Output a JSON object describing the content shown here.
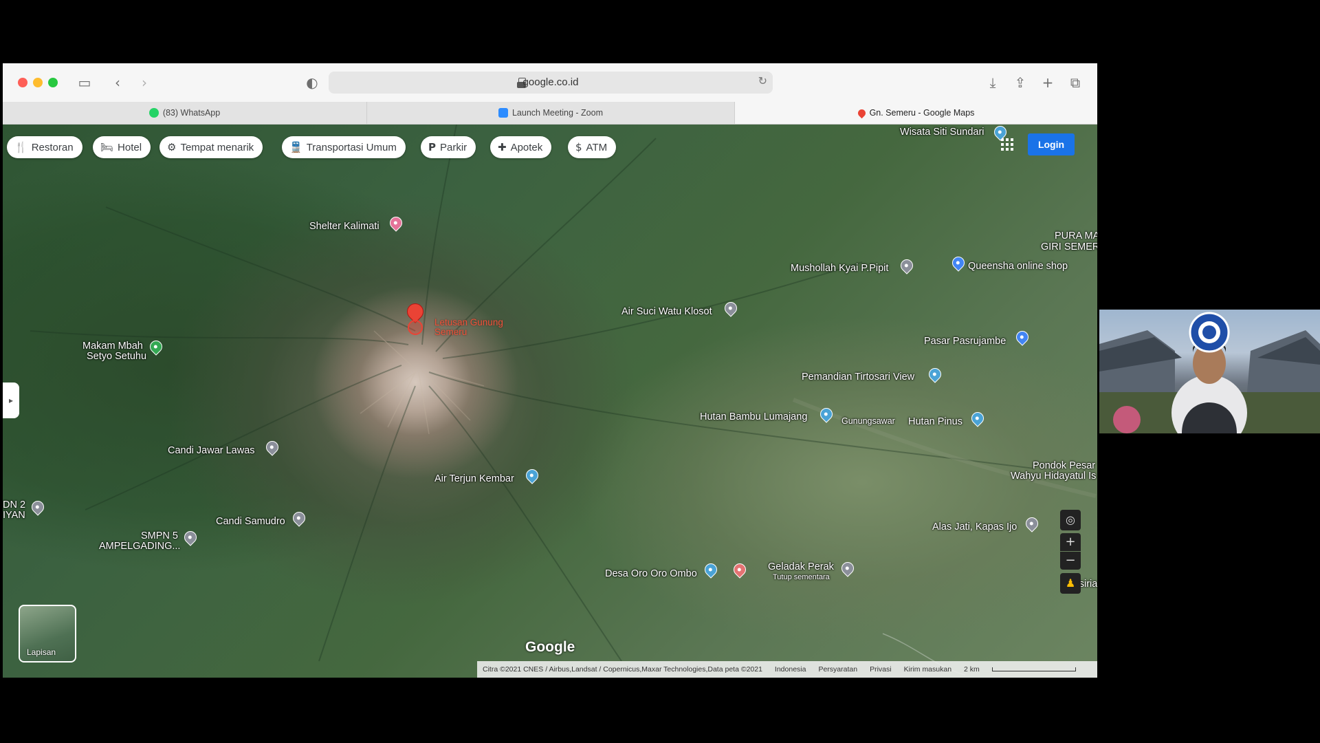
{
  "browser": {
    "url": "google.co.id",
    "tabs": [
      {
        "label": "(83) WhatsApp",
        "icon": "whatsapp-icon",
        "color": "#25d366"
      },
      {
        "label": "Launch Meeting - Zoom",
        "icon": "zoom-icon",
        "color": "#2d8cff"
      },
      {
        "label": "Gn. Semeru - Google Maps",
        "icon": "google-maps-icon",
        "color": "#ea4335"
      }
    ]
  },
  "chips": [
    {
      "label": "Restoran",
      "icon": "restaurant-icon",
      "glyph": "🍴"
    },
    {
      "label": "Hotel",
      "icon": "hotel-icon",
      "glyph": "🛏"
    },
    {
      "label": "Tempat menarik",
      "icon": "attraction-icon",
      "glyph": "⚙"
    },
    {
      "label": "Transportasi Umum",
      "icon": "transit-icon",
      "glyph": "🚆"
    },
    {
      "label": "Parkir",
      "icon": "parking-icon",
      "glyph": "P"
    },
    {
      "label": "Apotek",
      "icon": "pharmacy-icon",
      "glyph": "✚"
    },
    {
      "label": "ATM",
      "icon": "atm-icon",
      "glyph": "$"
    }
  ],
  "header": {
    "login_label": "Login"
  },
  "places": {
    "wisata": "Wisata Siti Sundari",
    "shelter": "Shelter Kalimati",
    "pura1": "PURA MA",
    "pura2": "GIRI SEMERU",
    "mushollah": "Mushollah Kyai P.Pipit",
    "queensha": "Queensha online shop",
    "letusan1": "Letusan Gunung",
    "letusan2": "Semeru",
    "air_suci": "Air Suci Watu Klosot",
    "makam1": "Makam Mbah",
    "makam2": "Setyo Setuhu",
    "pasar": "Pasar Pasrujambe",
    "pemandian": "Pemandian Tirtosari View",
    "hutan_bambu": "Hutan Bambu Lumajang",
    "gunungsawar": "Gunungsawar",
    "hutan_pinus": "Hutan Pinus",
    "candi_jawar": "Candi Jawar Lawas",
    "pondok1": "Pondok Pesar",
    "pondok2": "Wahyu Hidayatul Is",
    "air_terjun": "Air Terjun Kembar",
    "dn1": "DN 2",
    "dn2": "IYAN",
    "candi_samudro": "Candi Samudro",
    "smpn1": "SMPN 5",
    "smpn2": "AMPELGADING...",
    "alas_jati": "Alas Jati, Kapas Ijo",
    "desa": "Desa Oro Oro Ombo",
    "geladak": "Geladak Perak",
    "geladak_sub": "Tutup sementara",
    "pasirian": "Pasiria"
  },
  "map": {
    "layers_label": "Lapisan",
    "google_logo": "Google",
    "footer": {
      "imagery": "Citra ©2021 CNES / Airbus,Landsat / Copernicus,Maxar Technologies,Data peta ©2021",
      "country": "Indonesia",
      "terms": "Persyaratan",
      "privacy": "Privasi",
      "feedback": "Kirim masukan",
      "scale": "2 km"
    }
  }
}
